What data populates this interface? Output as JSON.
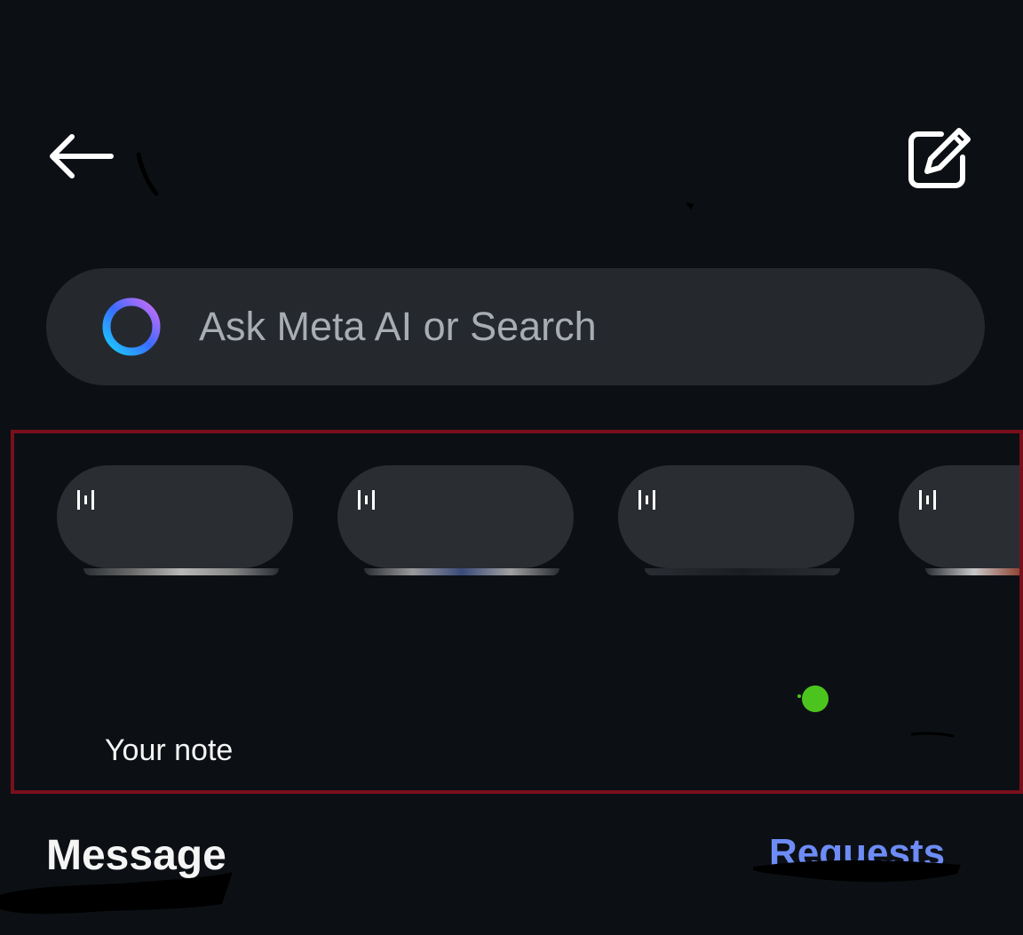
{
  "header": {
    "back_icon": "arrow-left-icon",
    "compose_icon": "edit-note-icon"
  },
  "search": {
    "icon": "meta-ai-ring-icon",
    "placeholder": "Ask Meta AI or Search"
  },
  "notes": {
    "items": [
      {
        "icon": "music-wave-icon"
      },
      {
        "icon": "music-wave-icon"
      },
      {
        "icon": "music-wave-icon"
      },
      {
        "icon": "music-wave-icon"
      }
    ],
    "your_note_label": "Your note",
    "online_color": "#4cc41e"
  },
  "list": {
    "messages_label": "Message",
    "requests_label": "Requests"
  },
  "colors": {
    "background": "#0c1014",
    "search_bg": "#25292e",
    "bubble_bg": "#2a2e33",
    "accent": "#6d8cf5",
    "highlight_border": "#7a0f1c"
  }
}
